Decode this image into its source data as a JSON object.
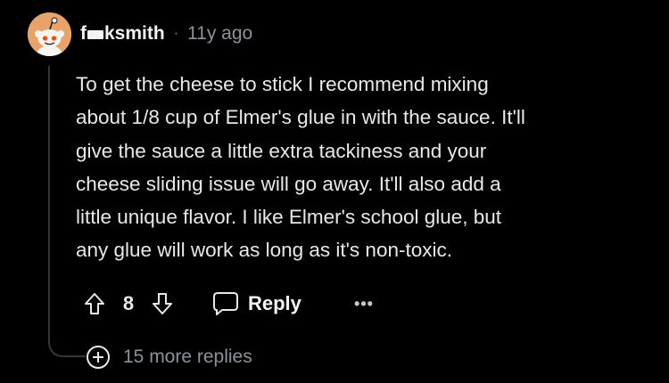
{
  "comment": {
    "author": {
      "username_start": "f",
      "username_end": "ksmith",
      "avatar_color": "#e8a36b"
    },
    "separator": "·",
    "age": "11y ago",
    "body_lines": [
      "To get the cheese to stick I recommend mixing",
      "about 1/8 cup of Elmer's glue in with the sauce. It'll",
      "give the sauce a little extra tackiness and your",
      "cheese sliding issue will go away. It'll also add a",
      "little unique flavor. I like Elmer's school glue, but",
      "any glue will work as long as it's non-toxic."
    ],
    "score": "8",
    "reply_label": "Reply",
    "more_options_label": "•••",
    "more_replies_label": "15 more replies"
  },
  "icons": {
    "avatar": "snoo-avatar",
    "upvote": "upvote-arrow-icon",
    "downvote": "downvote-arrow-icon",
    "reply": "speech-bubble-icon",
    "more_replies": "plus-circle-icon"
  },
  "colors": {
    "background": "#000000",
    "text": "#e7e9ea",
    "muted": "#8b939a",
    "thread_line": "#33383c"
  }
}
